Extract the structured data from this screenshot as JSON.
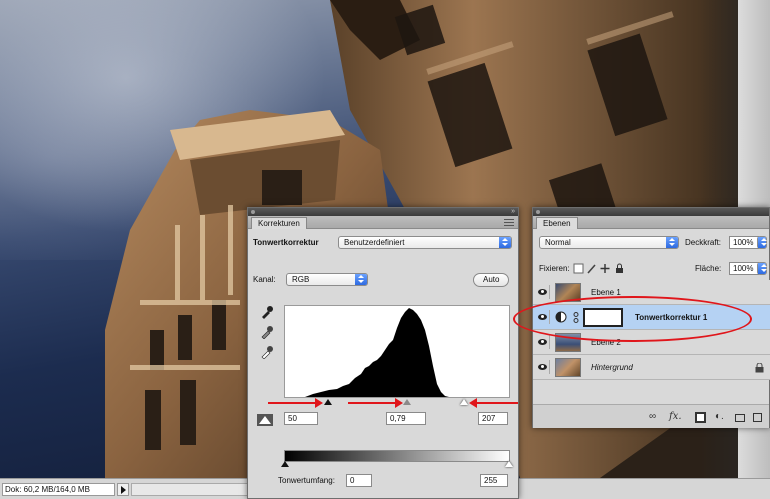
{
  "status": {
    "doc_info": "Dok: 60,2 MB/164,0 MB"
  },
  "korrekturen": {
    "tab_label": "Korrekturen",
    "heading": "Tonwertkorrektur",
    "preset_value": "Benutzerdefiniert",
    "kanal_label": "Kanal:",
    "kanal_value": "RGB",
    "auto_label": "Auto",
    "input_black": "50",
    "input_gamma": "0,79",
    "input_white": "207",
    "output_label": "Tonwertumfang:",
    "output_black": "0",
    "output_white": "255"
  },
  "ebenen": {
    "tab_label": "Ebenen",
    "blend_mode": "Normal",
    "opacity_label": "Deckkraft:",
    "opacity_value": "100%",
    "lock_label": "Fixieren:",
    "fill_label": "Fläche:",
    "fill_value": "100%",
    "layers": [
      {
        "name": "Ebene 1",
        "selected": false
      },
      {
        "name": "Tonwertkorrektur 1",
        "selected": true
      },
      {
        "name": "Ebene 2",
        "selected": false
      },
      {
        "name": "Hintergrund",
        "selected": false
      }
    ]
  },
  "icons": [
    "eyedropper-black-icon",
    "eyedropper-gray-icon",
    "eyedropper-white-icon",
    "eye-icon",
    "link-icon",
    "lock-icon",
    "panel-menu-icon",
    "adjustment-icon"
  ],
  "colors": {
    "highlight_annotation": "#e0161b",
    "selected_layer": "#b5d2f3",
    "select_arrow": "#2e6ae0"
  }
}
